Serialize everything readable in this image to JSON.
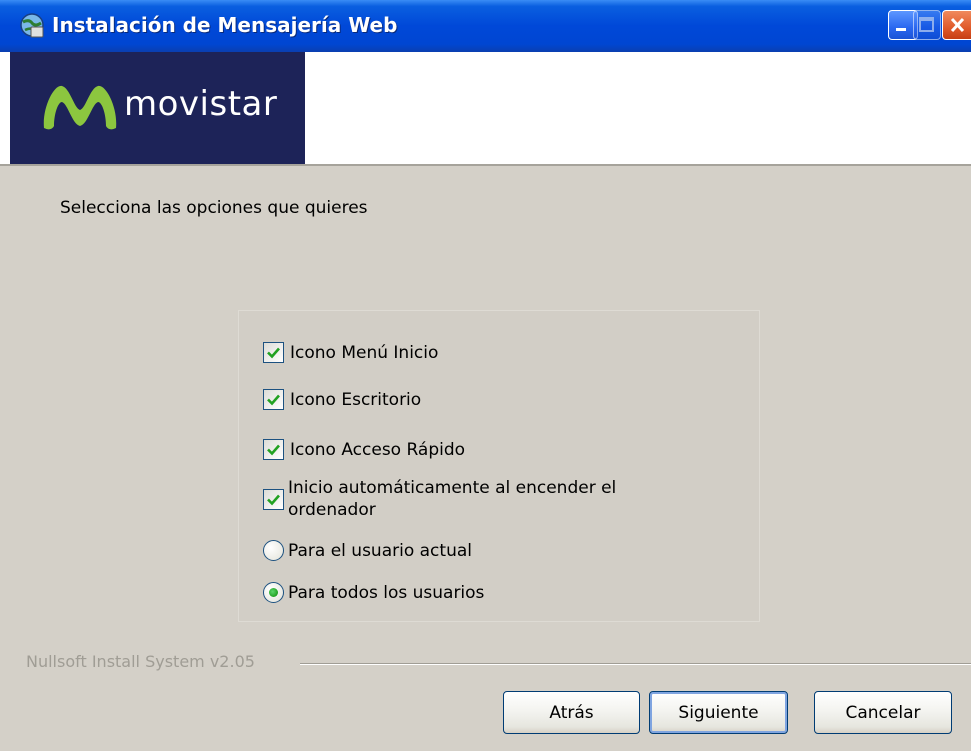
{
  "window": {
    "title": "Instalación de Mensajería Web",
    "title_icon": "installer-globe-icon",
    "controls": {
      "minimize_icon": "minimize-icon",
      "maximize_icon": "maximize-icon",
      "close_icon": "close-icon"
    }
  },
  "banner": {
    "brand_name": "movistar",
    "brand_logo_icon": "movistar-m-logo",
    "brand_bg_color": "#1d2358",
    "brand_logo_color": "#8cc63f"
  },
  "main": {
    "instruction": "Selecciona las opciones que quieres",
    "options": [
      {
        "label": "Icono Menú Inicio",
        "type": "checkbox",
        "checked": true
      },
      {
        "label": "Icono Escritorio",
        "type": "checkbox",
        "checked": true
      },
      {
        "label": "Icono Acceso Rápido",
        "type": "checkbox",
        "checked": true
      },
      {
        "label": "Inicio automáticamente al encender el ordenador",
        "type": "checkbox",
        "checked": true
      },
      {
        "label": "Para el usuario actual",
        "type": "radio",
        "checked": false
      },
      {
        "label": "Para todos los usuarios",
        "type": "radio",
        "checked": true
      }
    ]
  },
  "footer": {
    "branding_text": "Nullsoft Install System v2.05",
    "buttons": {
      "back": "Atrás",
      "next": "Siguiente",
      "cancel": "Cancelar"
    }
  },
  "colors": {
    "titlebar": "#0048d8",
    "dialog_bg": "#d4d0c8",
    "check_mark": "#21a121"
  }
}
